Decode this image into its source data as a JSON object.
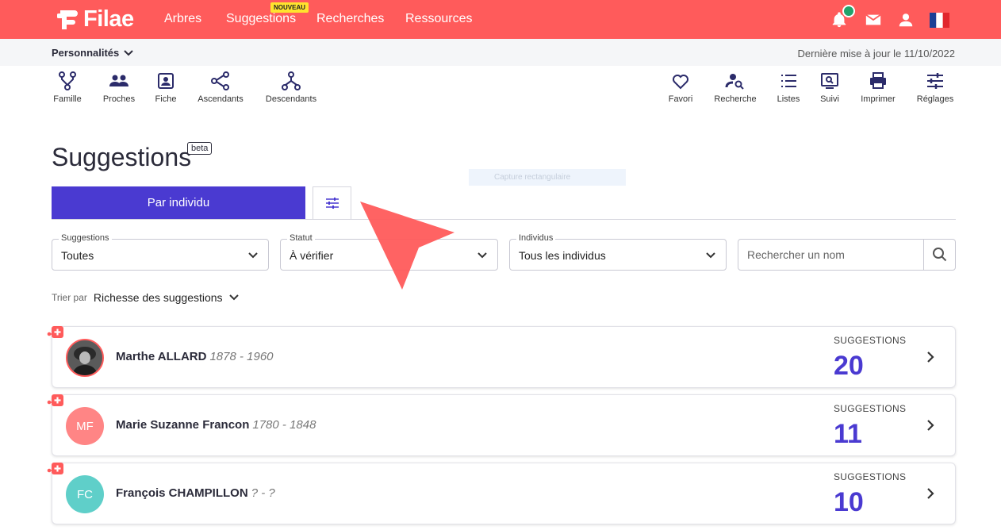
{
  "brand": {
    "name": "Filae",
    "color": "#ff5b5b",
    "accent": "#4a3ad1"
  },
  "topnav": {
    "links": [
      "Arbres",
      "Suggestions",
      "Recherches",
      "Ressources"
    ],
    "badge": "NOUVEAU",
    "icons": [
      "bell-icon",
      "mail-icon",
      "user-icon",
      "french-flag-icon"
    ]
  },
  "subbar": {
    "tree_name": "Personnalités",
    "last_update": "Dernière mise à jour le 11/10/2022"
  },
  "toolbar_left": [
    {
      "label": "Famille",
      "icon": "family-tree-icon"
    },
    {
      "label": "Proches",
      "icon": "people-icon"
    },
    {
      "label": "Fiche",
      "icon": "id-card-icon"
    },
    {
      "label": "Ascendants",
      "icon": "ancestors-icon"
    },
    {
      "label": "Descendants",
      "icon": "descendants-icon"
    }
  ],
  "toolbar_right": [
    {
      "label": "Favori",
      "icon": "heart-icon"
    },
    {
      "label": "Recherche",
      "icon": "person-search-icon"
    },
    {
      "label": "Listes",
      "icon": "list-icon"
    },
    {
      "label": "Suivi",
      "icon": "monitor-icon"
    },
    {
      "label": "Imprimer",
      "icon": "printer-icon"
    },
    {
      "label": "Réglages",
      "icon": "sliders-icon"
    }
  ],
  "page": {
    "title": "Suggestions",
    "badge": "beta"
  },
  "tabs": {
    "active": "Par individu"
  },
  "ghost_overlay": "Capture rectangulaire",
  "filters": {
    "suggestions": {
      "label": "Suggestions",
      "value": "Toutes"
    },
    "statut": {
      "label": "Statut",
      "value": "À vérifier"
    },
    "individus": {
      "label": "Individus",
      "value": "Tous les individus"
    },
    "search_placeholder": "Rechercher un nom"
  },
  "sort": {
    "label": "Trier par",
    "value": "Richesse des suggestions"
  },
  "individuals": [
    {
      "name": "Marthe ALLARD",
      "dates": "1878 - 1960",
      "initials": "",
      "avatar_color": "#6d6d6d",
      "suggestions_label": "SUGGESTIONS",
      "count": "20"
    },
    {
      "name": "Marie Suzanne Francon",
      "dates": "1780 - 1848",
      "initials": "MF",
      "avatar_color": "#ff8585",
      "suggestions_label": "SUGGESTIONS",
      "count": "11"
    },
    {
      "name": "François CHAMPILLON",
      "dates": "? - ?",
      "initials": "FC",
      "avatar_color": "#5fcfc9",
      "suggestions_label": "SUGGESTIONS",
      "count": "10"
    }
  ]
}
